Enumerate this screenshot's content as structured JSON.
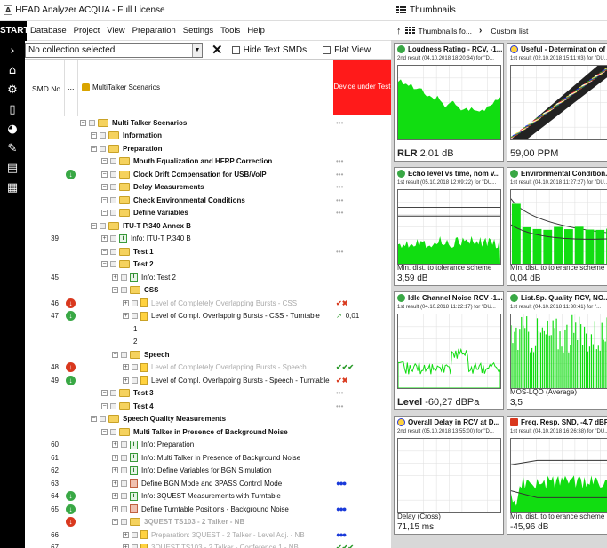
{
  "window": {
    "app_icon": "A",
    "title": "HEAD Analyzer ACQUA - Full License"
  },
  "thumbs_panel": {
    "title": "Thumbnails",
    "crumb1": "Thumbnails fo...",
    "crumb2": "Custom list"
  },
  "menu": {
    "start": "START",
    "items": [
      "Database",
      "Project",
      "View",
      "Preparation",
      "Settings",
      "Tools",
      "Help"
    ]
  },
  "collection": {
    "selected": "No collection selected",
    "hide_text_smds": "Hide Text SMDs",
    "flat_view": "Flat View"
  },
  "columns": {
    "smd_no": "SMD No",
    "dots": "...",
    "name": "MultiTalker Scenarios",
    "dut": "Device under Test",
    "dut_color": "#ff1a1a"
  },
  "tree": [
    {
      "num": "",
      "status": "",
      "label": "Multi Talker Scenarios",
      "bold": true,
      "indent": 0,
      "icon": "folder",
      "res": "dots"
    },
    {
      "num": "",
      "status": "",
      "label": "Information",
      "bold": true,
      "indent": 1,
      "icon": "folder",
      "res": ""
    },
    {
      "num": "",
      "status": "",
      "label": "Preparation",
      "bold": true,
      "indent": 1,
      "icon": "folder",
      "res": ""
    },
    {
      "num": "",
      "status": "",
      "label": "Mouth Equalization and HFRP Correction",
      "bold": true,
      "indent": 2,
      "icon": "folder",
      "res": "dots"
    },
    {
      "num": "",
      "status": "green",
      "label": "Clock Drift Compensation for USB/VoIP",
      "bold": true,
      "indent": 2,
      "icon": "folder",
      "res": "dots"
    },
    {
      "num": "",
      "status": "",
      "label": "Delay Measurements",
      "bold": true,
      "indent": 2,
      "icon": "folder",
      "res": "dots"
    },
    {
      "num": "",
      "status": "",
      "label": "Check Environmental Conditions",
      "bold": true,
      "indent": 2,
      "icon": "folder",
      "res": "dots"
    },
    {
      "num": "",
      "status": "",
      "label": "Define Variables",
      "bold": true,
      "indent": 2,
      "icon": "folder",
      "res": "dots"
    },
    {
      "num": "",
      "status": "",
      "label": "ITU-T P.340 Annex B",
      "bold": true,
      "indent": 1,
      "icon": "folder",
      "res": ""
    },
    {
      "num": "39",
      "status": "",
      "label": "Info: ITU-T P.340 B",
      "bold": false,
      "indent": 2,
      "icon": "info",
      "res": ""
    },
    {
      "num": "",
      "status": "",
      "label": "Test 1",
      "bold": true,
      "indent": 2,
      "icon": "folder",
      "res": "dots"
    },
    {
      "num": "",
      "status": "",
      "label": "Test 2",
      "bold": true,
      "indent": 2,
      "icon": "folder",
      "res": ""
    },
    {
      "num": "45",
      "status": "",
      "label": "Info: Test 2",
      "bold": false,
      "indent": 3,
      "icon": "info",
      "res": ""
    },
    {
      "num": "",
      "status": "",
      "label": "CSS",
      "bold": true,
      "indent": 3,
      "icon": "folder",
      "res": ""
    },
    {
      "num": "46",
      "status": "red",
      "label": "Level of Completely Overlapping Bursts - CSS",
      "bold": false,
      "dim": true,
      "indent": 4,
      "icon": "doc",
      "res": "xred"
    },
    {
      "num": "47",
      "status": "green",
      "label": "Level of Compl. Overlapping Bursts - CSS - Turntable",
      "bold": false,
      "indent": 4,
      "icon": "doc",
      "res": "trend",
      "res_val": "0,01"
    },
    {
      "num": "",
      "status": "",
      "label": "1",
      "bold": false,
      "indent": 5,
      "icon": "none",
      "res": ""
    },
    {
      "num": "",
      "status": "",
      "label": "2",
      "bold": false,
      "indent": 5,
      "icon": "none",
      "res": ""
    },
    {
      "num": "",
      "status": "",
      "label": "Speech",
      "bold": true,
      "indent": 3,
      "icon": "folder",
      "res": ""
    },
    {
      "num": "48",
      "status": "red",
      "label": "Level of Completely Overlapping Bursts - Speech",
      "bold": false,
      "dim": true,
      "indent": 4,
      "icon": "doc",
      "res": "check"
    },
    {
      "num": "49",
      "status": "green",
      "label": "Level of Compl. Overlapping Bursts - Speech - Turntable",
      "bold": false,
      "indent": 4,
      "icon": "doc",
      "res": "xred"
    },
    {
      "num": "",
      "status": "",
      "label": "Test 3",
      "bold": true,
      "indent": 2,
      "icon": "folder",
      "res": "dots"
    },
    {
      "num": "",
      "status": "",
      "label": "Test 4",
      "bold": true,
      "indent": 2,
      "icon": "folder",
      "res": "dots"
    },
    {
      "num": "",
      "status": "",
      "label": "Speech Quality Measurements",
      "bold": true,
      "indent": 1,
      "icon": "folder",
      "res": ""
    },
    {
      "num": "",
      "status": "",
      "label": "Multi Talker in Presence of Background Noise",
      "bold": true,
      "indent": 2,
      "icon": "folder",
      "res": ""
    },
    {
      "num": "60",
      "status": "",
      "label": "Info: Preparation",
      "bold": false,
      "indent": 3,
      "icon": "info",
      "res": ""
    },
    {
      "num": "61",
      "status": "",
      "label": "Info: Multi Talker in Presence of Background Noise",
      "bold": false,
      "indent": 3,
      "icon": "info",
      "res": ""
    },
    {
      "num": "62",
      "status": "",
      "label": "Info: Define Variables for BGN Simulation",
      "bold": false,
      "indent": 3,
      "icon": "info",
      "res": ""
    },
    {
      "num": "63",
      "status": "",
      "label": "Define BGN Mode and 3PASS Control Mode",
      "bold": false,
      "indent": 3,
      "icon": "macro",
      "res": "blue"
    },
    {
      "num": "64",
      "status": "green",
      "label": "Info: 3QUEST Measurements with Turntable",
      "bold": false,
      "indent": 3,
      "icon": "info",
      "res": ""
    },
    {
      "num": "65",
      "status": "green",
      "label": "Define Turntable Positions - Background Noise",
      "bold": false,
      "indent": 3,
      "icon": "macro",
      "res": "blue"
    },
    {
      "num": "",
      "status": "red",
      "label": "3QUEST TS103 - 2 Talker - NB",
      "bold": true,
      "dim": true,
      "indent": 3,
      "icon": "folder",
      "res": ""
    },
    {
      "num": "66",
      "status": "",
      "label": "Preparation: 3QUEST - 2 Talker - Level Adj. - NB",
      "bold": false,
      "dim": true,
      "indent": 4,
      "icon": "doc",
      "res": "blue"
    },
    {
      "num": "67",
      "status": "",
      "label": "3QUEST TS103 - 2 Talker - Conference 1 - NB",
      "bold": false,
      "dim": true,
      "indent": 4,
      "icon": "doc",
      "res": "check"
    }
  ],
  "thumbnails": [
    {
      "title": "Loudness Rating - RCV, -1...",
      "icon": "ok",
      "sub": "2nd result (04.10.2018 18:20:34) for \"D...",
      "foot_label": "RLR",
      "foot_value": "2,01 dB",
      "plot": "steps"
    },
    {
      "title": "Useful - Determination of ...",
      "icon": "warn",
      "sub": "1st result (02.10.2018 15:11:03) for \"DU...",
      "foot_label": "",
      "foot_value": "59,00 PPM",
      "plot": "diag"
    },
    {
      "title": "Echo level vs time, nom v...",
      "icon": "ok",
      "sub": "1st result (05.10.2018 12:09:22) for \"DU...",
      "foot_label": "Min. dist. to tolerance scheme",
      "foot_value": "3,59 dB",
      "plot": "echo"
    },
    {
      "title": "Environmental Condition...",
      "icon": "ok",
      "sub": "1st result (04.10.2018 11:27:27) for \"DU...",
      "foot_label": "Min. dist. to tolerance scheme",
      "foot_value": "0,04 dB",
      "plot": "bars"
    },
    {
      "title": "Idle Channel Noise RCV -1...",
      "icon": "ok",
      "sub": "1st result (04.10.2018 11:22:17) for \"DU...",
      "foot_label": "Level",
      "foot_value": "-60,27 dBPa",
      "plot": "noise"
    },
    {
      "title": "List.Sp. Quality RCV, NO...",
      "icon": "ok",
      "sub": "1st result (04.10.2018 11:30:41) for \"...",
      "foot_label": "MOS-LQO (Average)",
      "foot_value": "3,5",
      "plot": "spikes"
    },
    {
      "title": "Overall Delay in RCV at D...",
      "icon": "warn",
      "sub": "2nd result (05.10.2018 13:55:00) for \"D...",
      "foot_label": "Delay (Cross)",
      "foot_value": "71,15 ms",
      "plot": "empty"
    },
    {
      "title": "Freq. Resp. SND, -4.7 dBPa",
      "icon": "err",
      "sub": "1st result (04.10.2018 16:26:38) for \"DU...",
      "foot_label": "Min. dist. to tolerance scheme",
      "foot_value": "-45,96 dB",
      "plot": "freq"
    }
  ]
}
